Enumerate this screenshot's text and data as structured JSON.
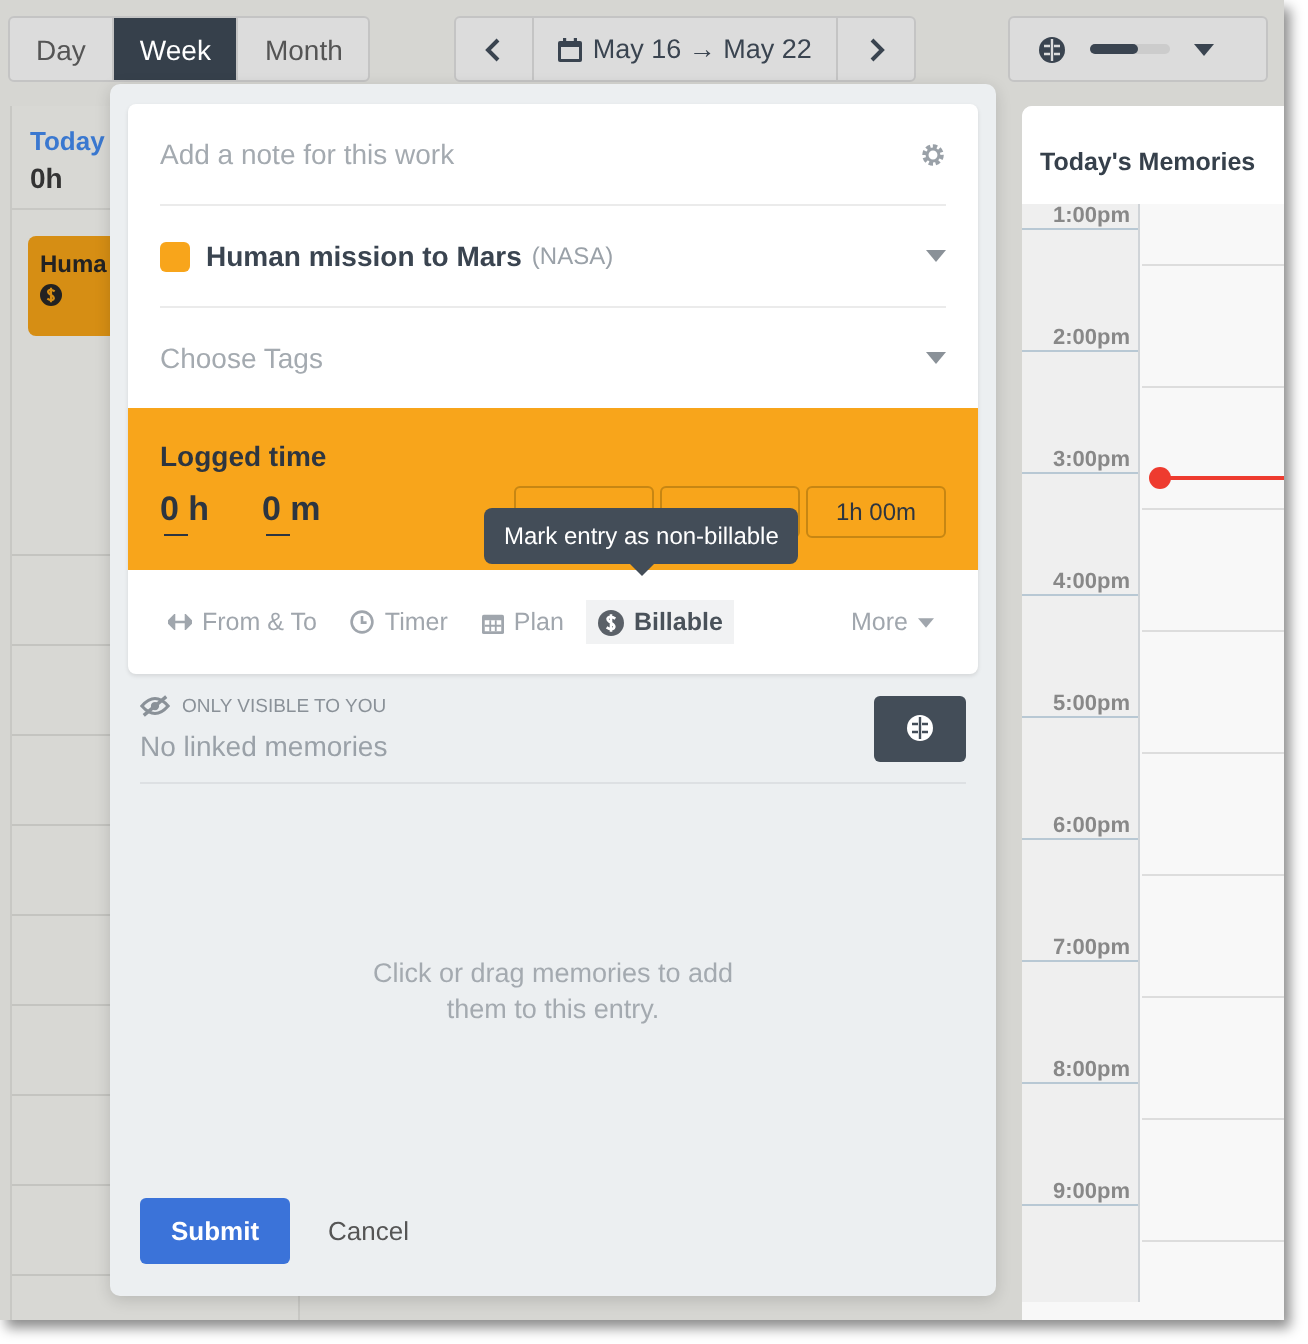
{
  "view_tabs": [
    {
      "label": "Day",
      "selected": false
    },
    {
      "label": "Week",
      "selected": true
    },
    {
      "label": "Month",
      "selected": false
    }
  ],
  "date_range": "May 16 → May 22",
  "memory_filter": {
    "level": 0.6
  },
  "day_column": {
    "label": "Today",
    "total": "0h",
    "entry": {
      "title": "Huma"
    }
  },
  "memories_panel": {
    "title": "Today's Memories",
    "times": [
      "1:00pm",
      "2:00pm",
      "3:00pm",
      "4:00pm",
      "5:00pm",
      "6:00pm",
      "7:00pm",
      "8:00pm",
      "9:00pm"
    ]
  },
  "entry_form": {
    "note": {
      "placeholder": "Add a note for this work"
    },
    "project": {
      "name": "Human mission to Mars",
      "client": "(NASA)"
    },
    "tags": {
      "placeholder": "Choose Tags"
    },
    "logged_time": {
      "title": "Logged time",
      "hours": "0 h",
      "minutes": "0 m",
      "quick_buttons": [
        {
          "label": "1h 00m"
        }
      ]
    },
    "options": [
      {
        "label": "From & To",
        "kind": "range",
        "selected": false
      },
      {
        "label": "Timer",
        "kind": "timer",
        "selected": false
      },
      {
        "label": "Plan",
        "kind": "plan",
        "selected": false
      },
      {
        "label": "Billable",
        "kind": "billable",
        "selected": true
      }
    ],
    "more": "More",
    "tooltip": "Mark entry as non-billable",
    "visibility": "ONLY VISIBLE TO YOU",
    "linked": "No linked memories",
    "empty_hint": "Click or drag memories to add them to this entry.",
    "submit": "Submit",
    "cancel": "Cancel"
  }
}
